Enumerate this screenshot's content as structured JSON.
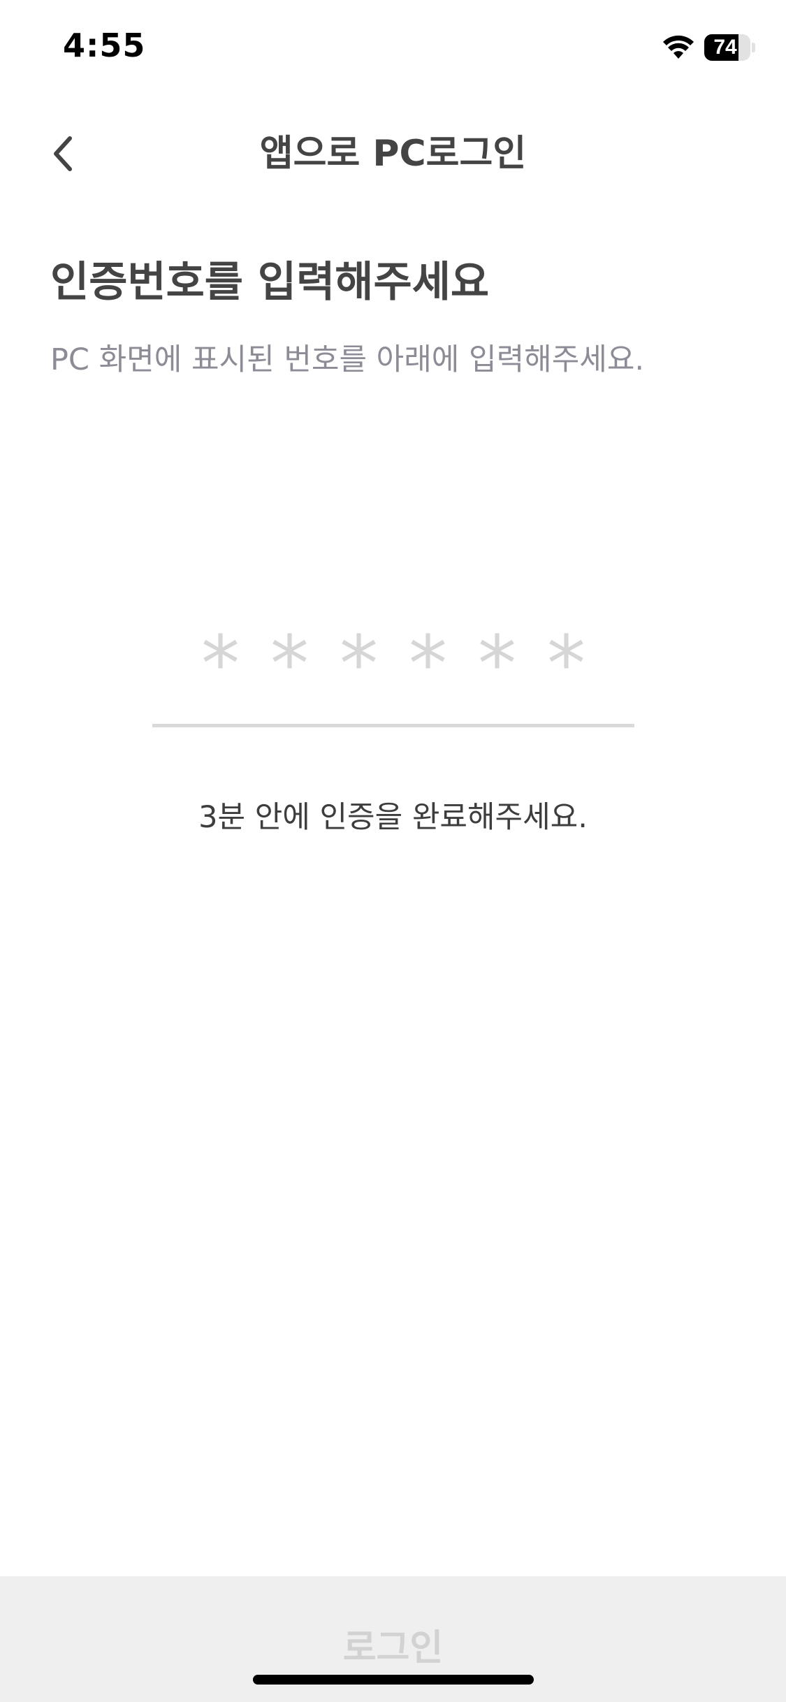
{
  "status_bar": {
    "time": "4:55",
    "battery_level": "74",
    "battery_fraction": 0.74,
    "wifi_icon": "wifi-icon",
    "battery_icon": "battery-icon"
  },
  "nav": {
    "back_icon": "chevron-left-icon",
    "title": "앱으로 PC로그인"
  },
  "main": {
    "heading": "인증번호를 입력해주세요",
    "subheading": "PC 화면에 표시된 번호를 아래에 입력해주세요."
  },
  "code_input": {
    "placeholder_dots": [
      "*",
      "*",
      "*",
      "*",
      "*",
      "*"
    ],
    "value": ""
  },
  "notice": {
    "timer_text": "3분 안에 인증을 완료해주세요."
  },
  "footer": {
    "login_label": "로그인"
  },
  "colors": {
    "text_primary": "#444444",
    "text_secondary": "#8c8c96",
    "placeholder": "#d6d6d6",
    "button_disabled_bg": "#efefef",
    "button_disabled_text": "#d2d2d2"
  }
}
